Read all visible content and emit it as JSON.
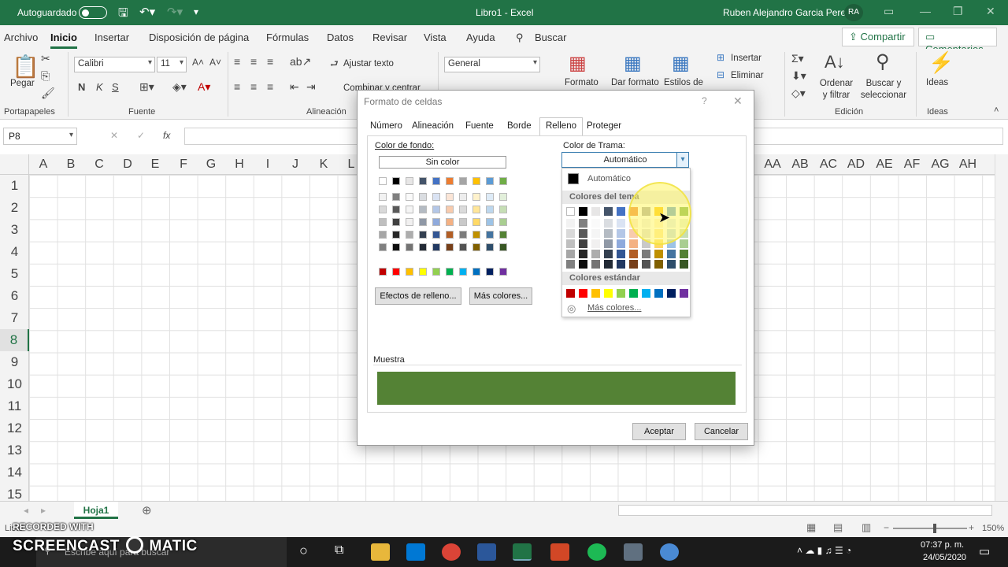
{
  "titlebar": {
    "autosave_label": "Autoguardado",
    "doc_title": "Libro1 - Excel",
    "user_name": "Ruben Alejandro Garcia Perez",
    "user_initials": "RA"
  },
  "tabs": [
    "Archivo",
    "Inicio",
    "Insertar",
    "Disposición de página",
    "Fórmulas",
    "Datos",
    "Revisar",
    "Vista",
    "Ayuda"
  ],
  "search_label": "Buscar",
  "share_label": "Compartir",
  "comments_label": "Comentarios",
  "ribbon": {
    "paste_label": "Pegar",
    "clipboard_group": "Portapapeles",
    "font_name": "Calibri",
    "font_size": "11",
    "bold": "N",
    "italic": "K",
    "underline": "S",
    "font_group": "Fuente",
    "wrap_text": "Ajustar texto",
    "merge_center": "Combinar y centrar",
    "alignment_group": "Alineación",
    "number_format": "General",
    "cond_format": "Formato",
    "format_as_table": "Dar formato",
    "cell_styles": "Estilos de",
    "insert": "Insertar",
    "delete": "Eliminar",
    "sort_filter": "Ordenar y filtrar",
    "find_select": "Buscar y seleccionar",
    "editing_group": "Edición",
    "ideas": "Ideas",
    "ideas_group": "Ideas"
  },
  "formula_bar": {
    "name_box": "P8",
    "fx": "fx"
  },
  "columns_left": [
    "A",
    "B",
    "C",
    "D",
    "E",
    "F",
    "G",
    "H",
    "I",
    "J",
    "K",
    "L"
  ],
  "columns_right": [
    "AA",
    "AB",
    "AC",
    "AD",
    "AE",
    "AF",
    "AG",
    "AH"
  ],
  "rows": [
    "1",
    "2",
    "3",
    "4",
    "5",
    "6",
    "7",
    "8",
    "9",
    "10",
    "11",
    "12",
    "13",
    "14",
    "15"
  ],
  "selected_row": "8",
  "sheet_tab": "Hoja1",
  "status": {
    "ready": "Listo",
    "zoom": "150%"
  },
  "dialog": {
    "title": "Formato de celdas",
    "tabs": [
      "Número",
      "Alineación",
      "Fuente",
      "Borde",
      "Relleno",
      "Proteger"
    ],
    "active_tab": "Relleno",
    "bg_color_label": "Color de fondo:",
    "no_color": "Sin color",
    "fill_effects": "Efectos de relleno...",
    "more_colors": "Más colores...",
    "pattern_color_label": "Color de Trama:",
    "pattern_color_value": "Automático",
    "sample_label": "Muestra",
    "sample_color": "#548235",
    "ok": "Aceptar",
    "cancel": "Cancelar"
  },
  "palette": {
    "automatic": "Automático",
    "theme_colors": "Colores del tema",
    "standard_colors": "Colores estándar",
    "more_colors": "Más colores..."
  },
  "colors": {
    "theme": [
      "#FFFFFF",
      "#000000",
      "#E7E6E6",
      "#44546A",
      "#4472C4",
      "#ED7D31",
      "#A5A5A5",
      "#FFC000",
      "#5B9BD5",
      "#70AD47"
    ],
    "standard": [
      "#C00000",
      "#FF0000",
      "#FFC000",
      "#FFFF00",
      "#92D050",
      "#00B050",
      "#00B0F0",
      "#0070C0",
      "#002060",
      "#7030A0"
    ],
    "excel_green": "#217346"
  },
  "taskbar": {
    "search_placeholder": "Escribe aquí para buscar",
    "time": "07:37 p. m.",
    "date": "24/05/2020"
  },
  "watermark": {
    "line1": "RECORDED WITH",
    "line2": "SCREENCAST",
    "line3": "MATIC"
  }
}
